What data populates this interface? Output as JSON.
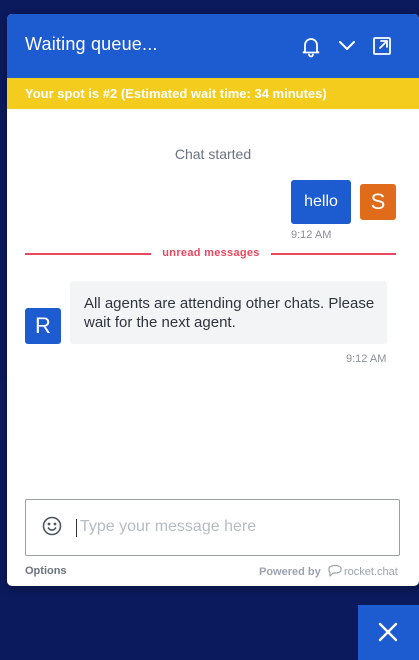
{
  "header": {
    "title": "Waiting queue...",
    "icons": [
      "bell-icon",
      "chevron-down-icon",
      "popout-icon"
    ]
  },
  "banner": {
    "text": "Your spot is #2 (Estimated wait time: 34 minutes)"
  },
  "messages": {
    "system": "Chat started",
    "outgoing": {
      "text": "hello",
      "avatar": "S",
      "time": "9:12 AM"
    },
    "unread_label": "unread messages",
    "incoming": {
      "text": "All agents are attending other chats. Please wait for the next agent.",
      "avatar": "R",
      "time": "9:12 AM"
    }
  },
  "composer": {
    "placeholder": "Type your message here",
    "value": ""
  },
  "footer": {
    "options_label": "Options",
    "powered_by": "Powered by",
    "brand": "rocket.chat"
  },
  "colors": {
    "brand_blue": "#1d5bd1",
    "queue_banner": "#f4cc1d",
    "user_avatar": "#e06c1b",
    "unread": "#e8475f",
    "page_background": "#0b1a5c"
  }
}
